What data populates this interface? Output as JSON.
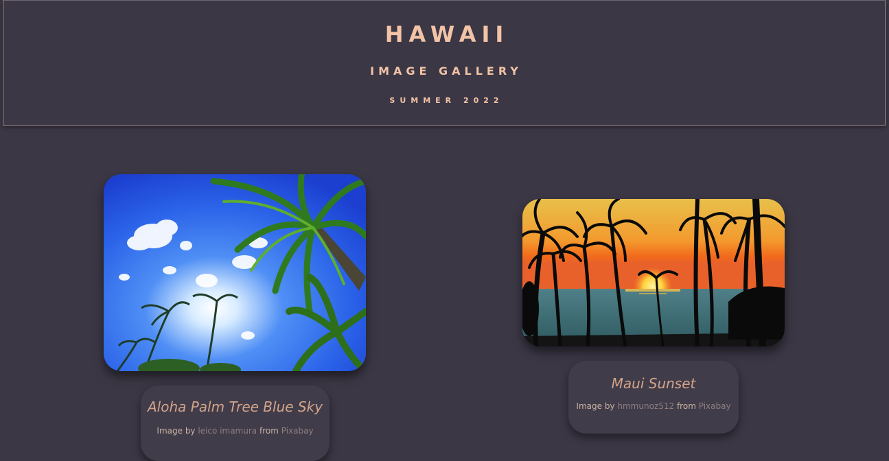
{
  "header": {
    "title": "HAWAII",
    "subtitle": "IMAGE GALLERY",
    "tagline": "SUMMER 2022"
  },
  "gallery": [
    {
      "caption_title": "Aloha Palm Tree Blue Sky",
      "credit_prefix": "Image by",
      "author": "leico imamura",
      "credit_middle": "from",
      "source": "Pixabay"
    },
    {
      "caption_title": "Maui Sunset",
      "credit_prefix": "Image by",
      "author": "hmmunoz512",
      "credit_middle": "from",
      "source": "Pixabay"
    }
  ],
  "colors": {
    "background": "#3b3745",
    "accent": "#f2c3a6",
    "caption_title": "#d4a489",
    "link": "#8e7f80"
  }
}
